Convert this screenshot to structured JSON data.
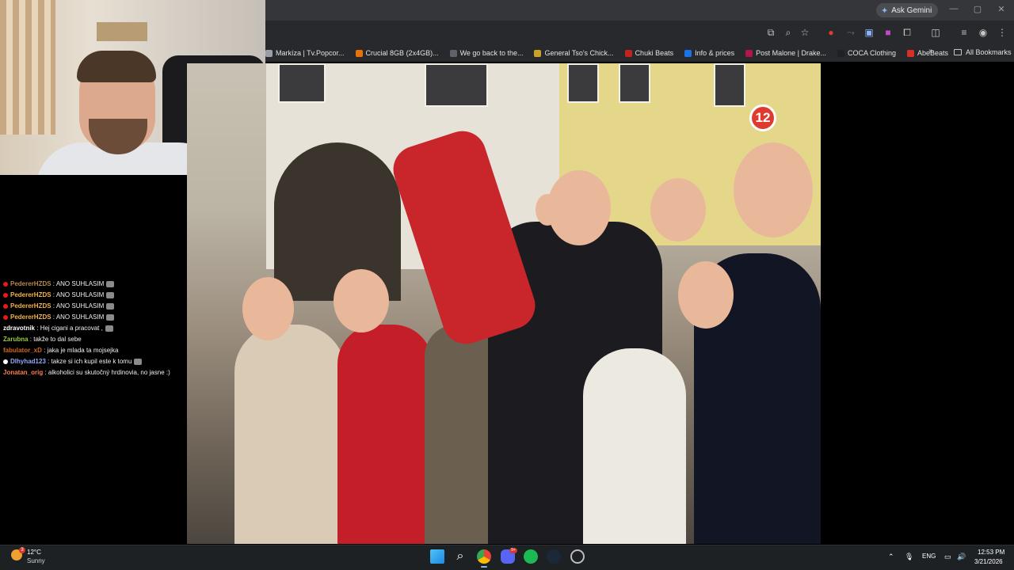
{
  "browser": {
    "ask_gemini_label": "Ask Gemini",
    "bookmarks": [
      {
        "label": "Markíza | Tv.Popcor...",
        "color": "#9aa0a6"
      },
      {
        "label": "Crucial 8GB (2x4GB)...",
        "color": "#e8710a"
      },
      {
        "label": "We go back to the...",
        "color": "#5f6368"
      },
      {
        "label": "General Tso's Chick...",
        "color": "#c9a227"
      },
      {
        "label": "Chuki Beats",
        "color": "#c5221f"
      },
      {
        "label": "Info & prices",
        "color": "#1a73e8"
      },
      {
        "label": "Post Malone | Drake...",
        "color": "#b0164a"
      },
      {
        "label": "COCA Clothing",
        "color": "#202124"
      },
      {
        "label": "AbeBeats",
        "color": "#d93025"
      }
    ],
    "all_bookmarks_label": "All Bookmarks"
  },
  "video": {
    "channel_logo_text": "12"
  },
  "chat": {
    "messages": [
      {
        "user": "PedererHZDS",
        "text": "ANO SUHLASIM",
        "user_color": "#b68a4c",
        "emote": true
      },
      {
        "user": "PedererHZDS",
        "text": "ANO SUHLASIM",
        "user_color": "#f2b34a",
        "emote": true
      },
      {
        "user": "PedererHZDS",
        "text": "ANO SUHLASIM",
        "user_color": "#f2b34a",
        "emote": true
      },
      {
        "user": "PedererHZDS",
        "text": "ANO SUHLASIM",
        "user_color": "#f2b34a",
        "emote": true
      },
      {
        "user": "zdravotnik",
        "text": "Hej cigani a pracovat ,",
        "user_color": "#ffffff",
        "emote": true
      },
      {
        "user": "Zarubna",
        "text": "takže to dal sebe",
        "user_color": "#9acd32",
        "emote": false
      },
      {
        "user": "fabulator_xD",
        "text": "jaka je mlada ta mojsejka",
        "user_color": "#d2691e",
        "emote": false
      },
      {
        "user": "Dlhyhad123",
        "text": "takze si ich kupil este k tomu",
        "user_color": "#8fa8ff",
        "emote": true
      },
      {
        "user": "Jonatan_orig",
        "text": "alkoholici su skutočný hrdinovia, no jasne :)",
        "user_color": "#ff7f50",
        "emote": false
      }
    ]
  },
  "taskbar": {
    "weather_badge": "3",
    "temperature": "12°C",
    "condition": "Sunny",
    "language": "ENG",
    "time": "12:53 PM",
    "date": "3/21/2026",
    "discord_badge": "9+"
  }
}
